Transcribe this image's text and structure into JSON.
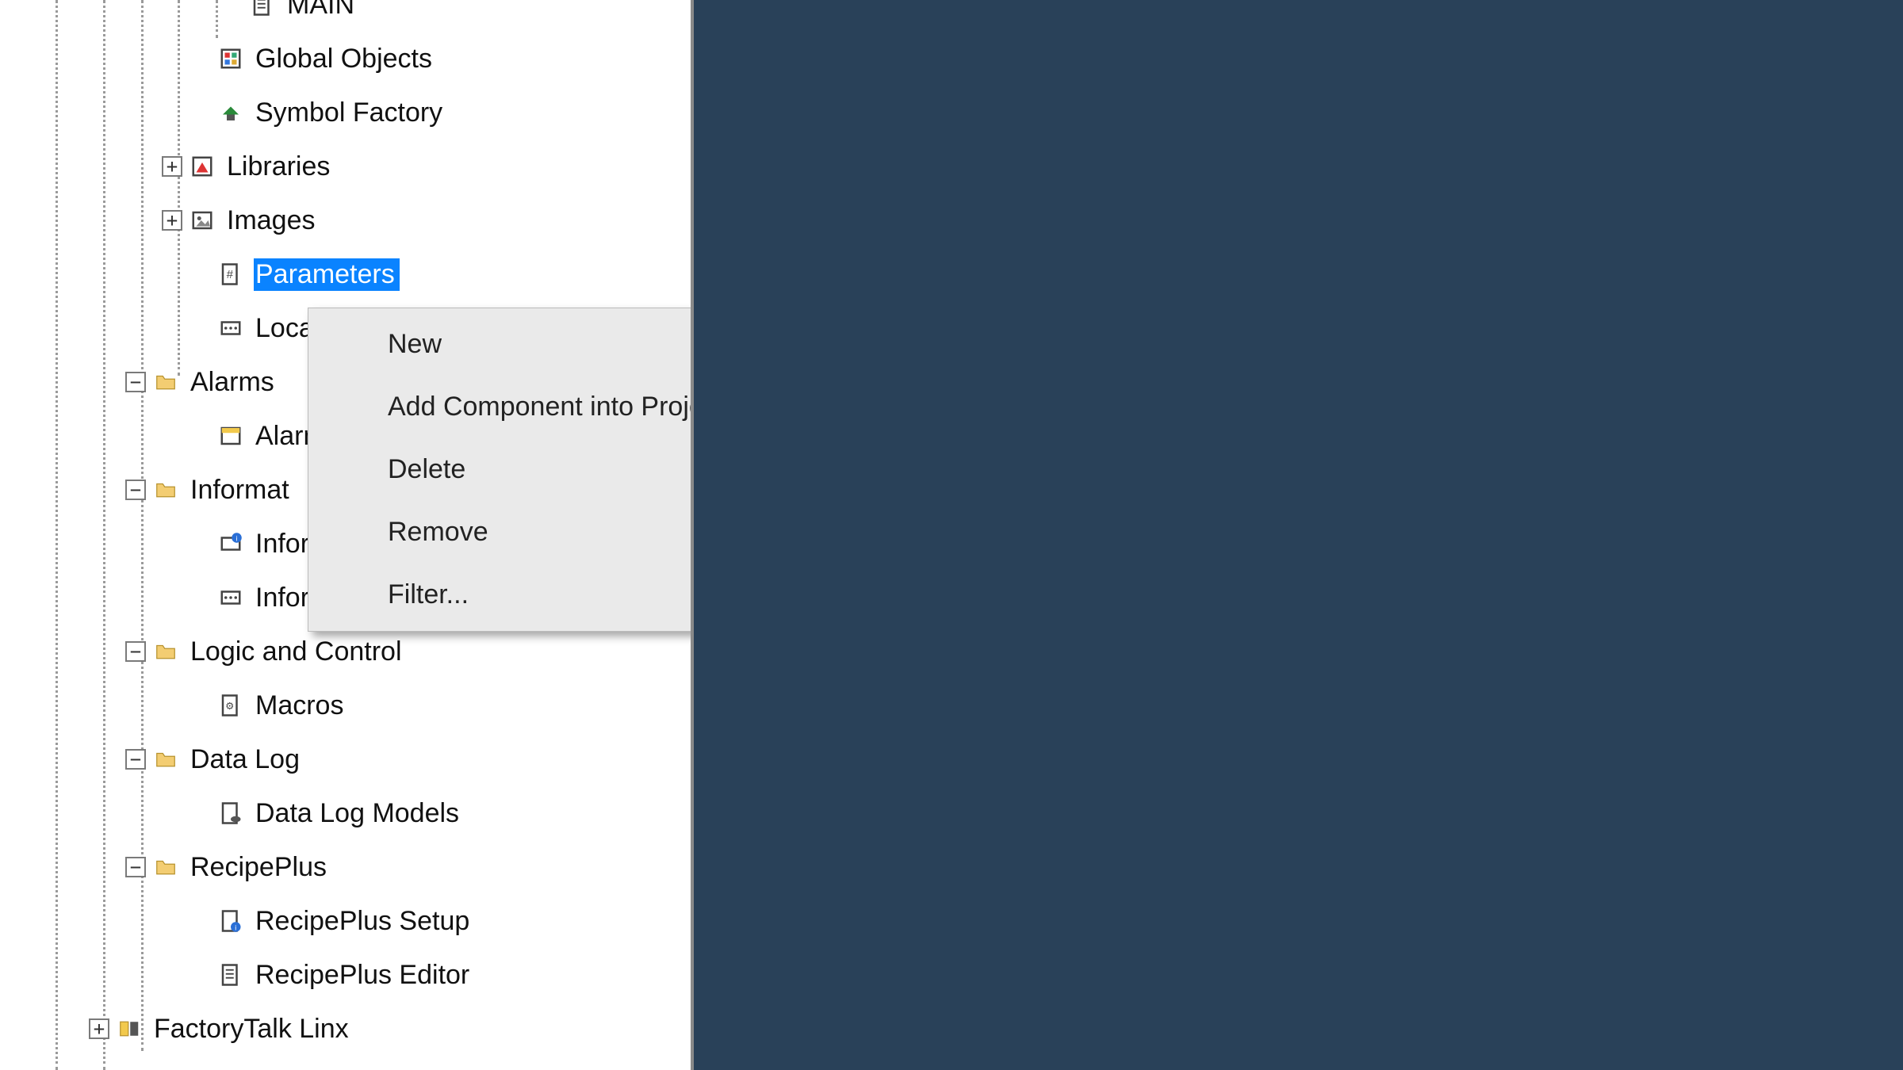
{
  "tree": {
    "main_label": "MAIN",
    "global_objects": "Global Objects",
    "symbol_factory": "Symbol Factory",
    "libraries": "Libraries",
    "images": "Images",
    "parameters": "Parameters",
    "local": "Local",
    "alarms": "Alarms",
    "alarm_child": "Alarm",
    "information": "Informat",
    "inform1": "Inforr",
    "inform2": "Infor",
    "logic": "Logic and Control",
    "macros": "Macros",
    "datalog": "Data Log",
    "datalog_models": "Data Log Models",
    "recipeplus": "RecipePlus",
    "recipeplus_setup": "RecipePlus Setup",
    "recipeplus_editor": "RecipePlus Editor",
    "ft_linx": "FactoryTalk Linx"
  },
  "context_menu": {
    "new": "New",
    "add_component": "Add Component into Project...",
    "delete": "Delete",
    "remove": "Remove",
    "filter": "Filter..."
  },
  "expander": {
    "plus": "+",
    "minus": "−"
  }
}
